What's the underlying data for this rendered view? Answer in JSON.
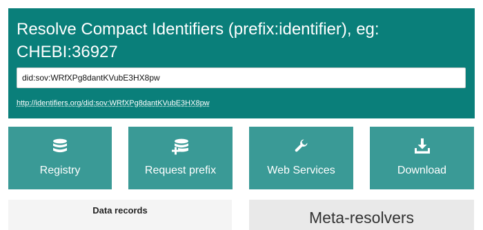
{
  "hero": {
    "title": "Resolve Compact Identifiers (prefix:identifier), eg: CHEBI:36927",
    "input_value": "did:sov:WRfXPg8dantKVubE3HX8pw",
    "resolved_link": "http://identifiers.org/did:sov:WRfXPg8dantKVubE3HX8pw",
    "background_color": "#0a7f7a"
  },
  "tiles": [
    {
      "label": "Registry",
      "icon": "database-icon"
    },
    {
      "label": "Request prefix",
      "icon": "database-add-icon"
    },
    {
      "label": "Web Services",
      "icon": "wrench-icon"
    },
    {
      "label": "Download",
      "icon": "download-icon"
    }
  ],
  "tile_color": "#3a9a96",
  "sections": {
    "data_records_title": "Data records",
    "meta_resolvers_title": "Meta-resolvers"
  }
}
